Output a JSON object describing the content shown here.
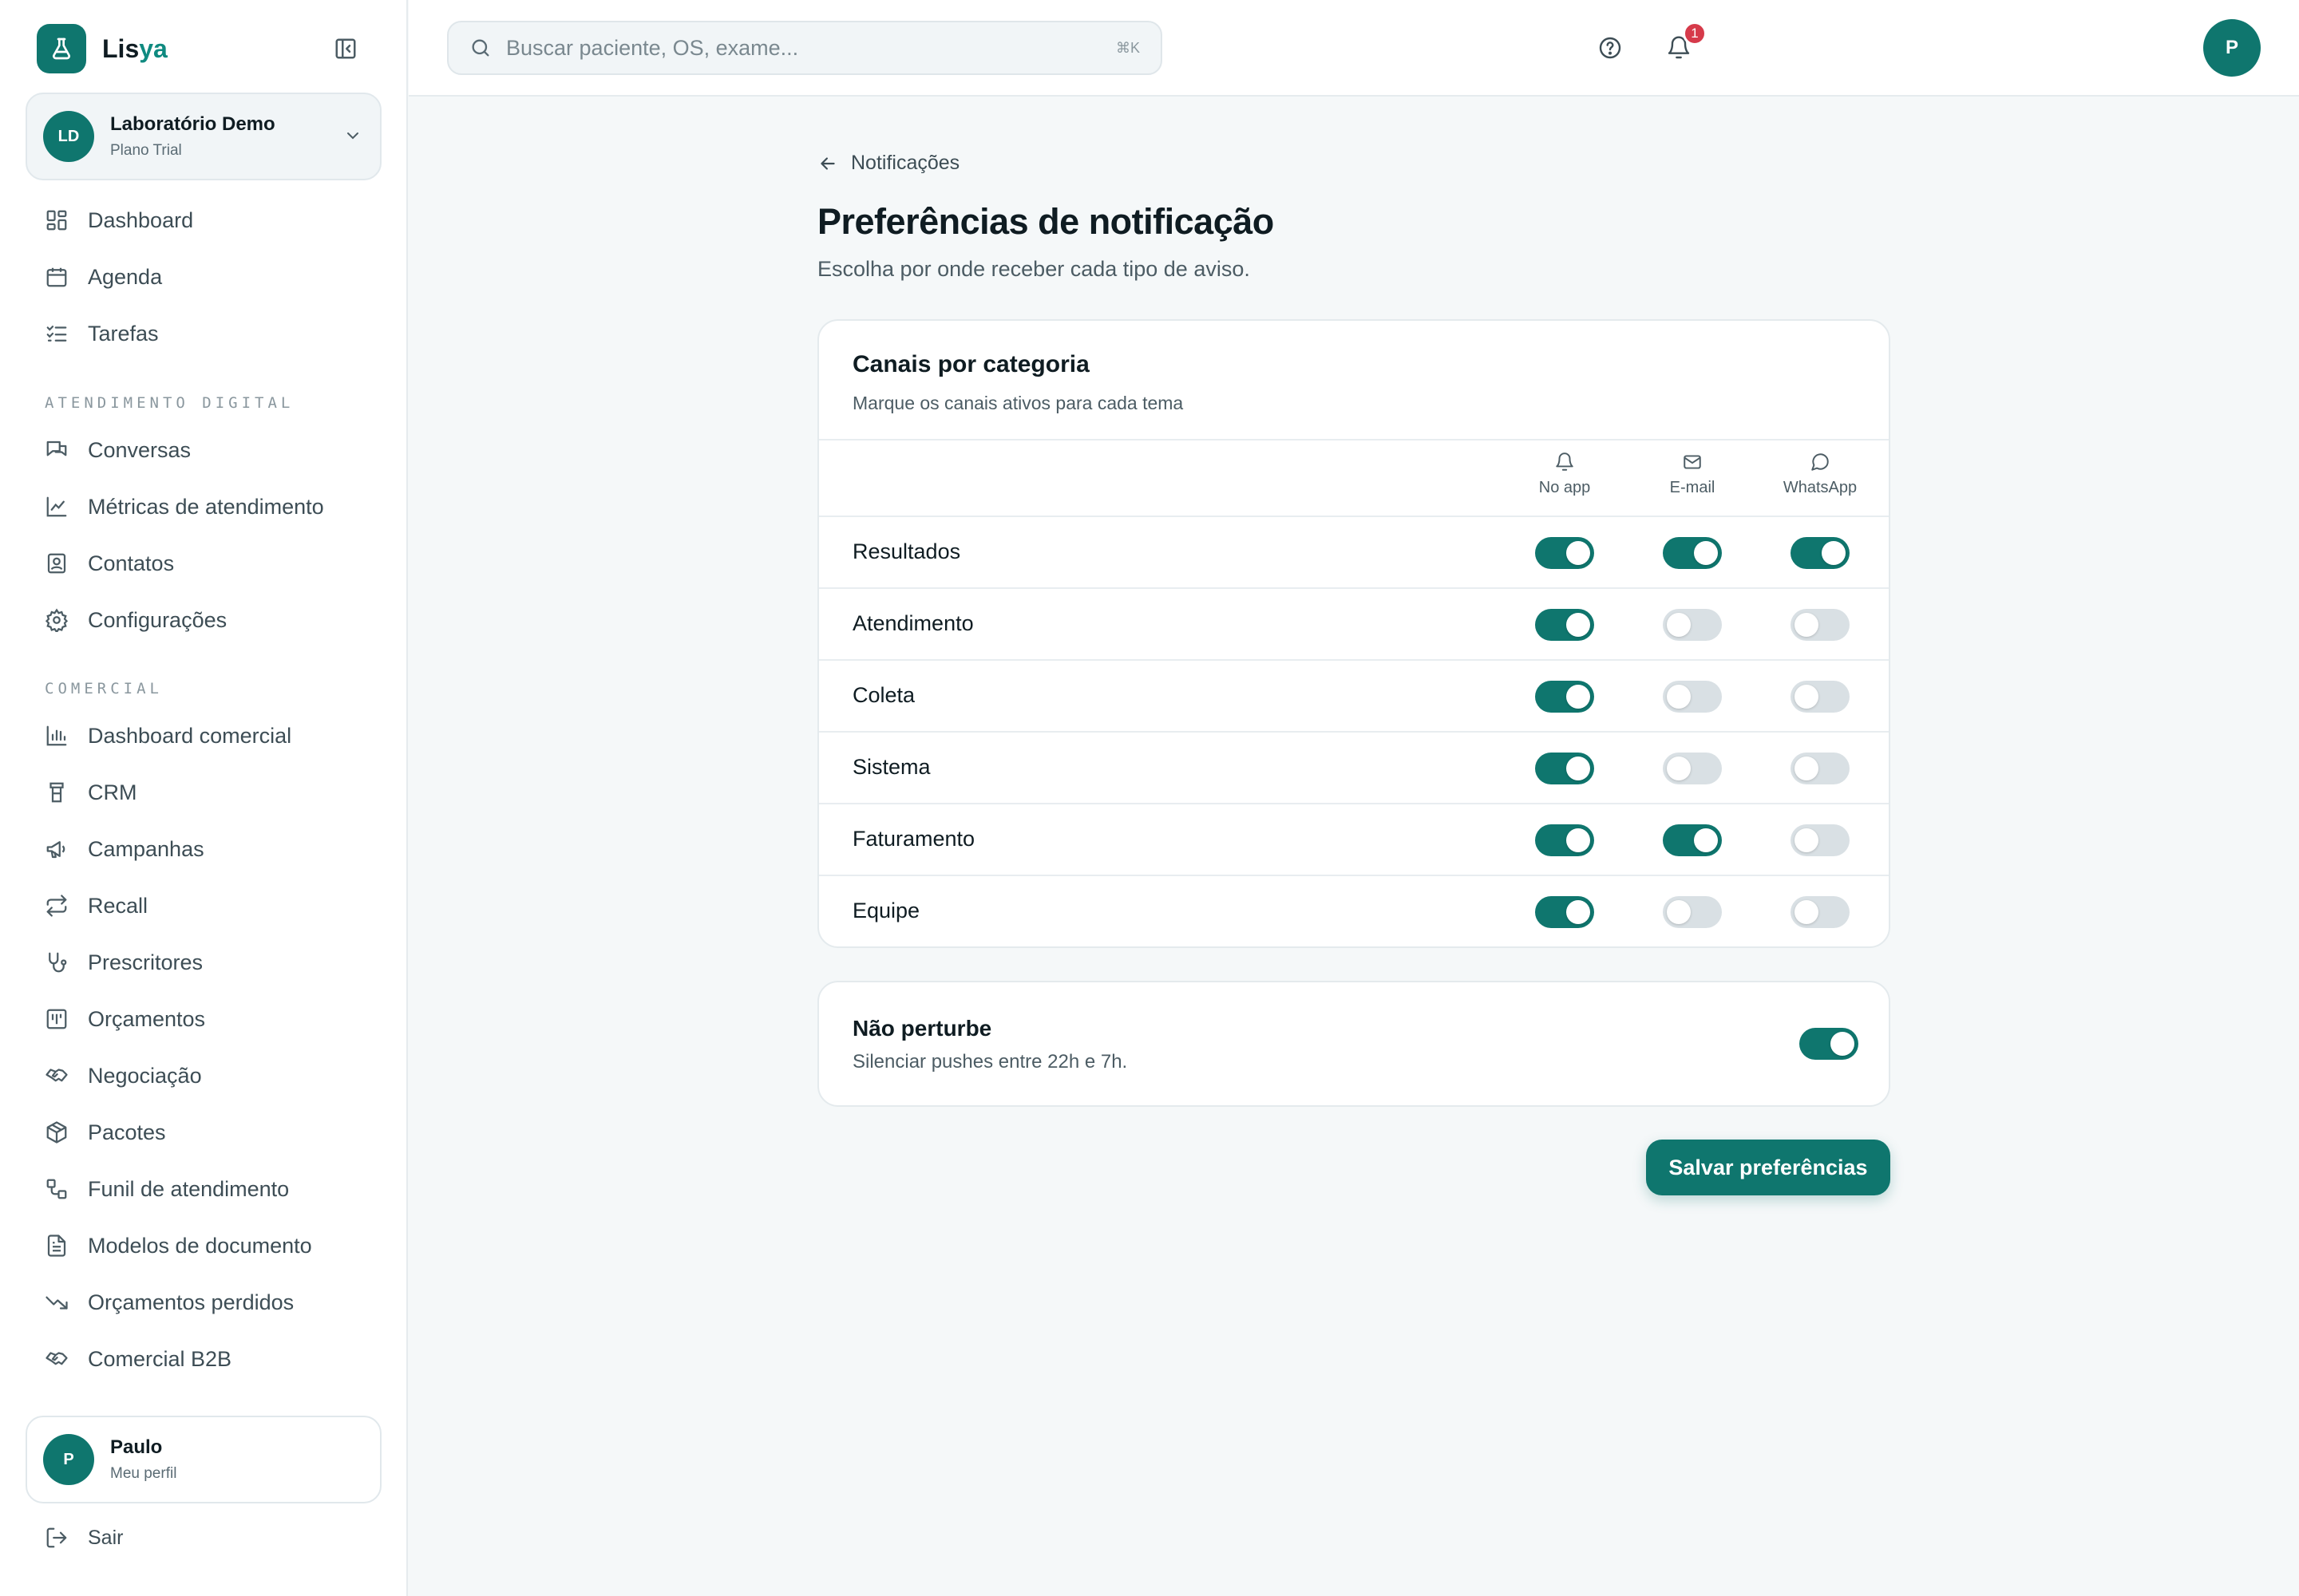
{
  "brand": {
    "name_part1": "Lis",
    "name_part2": "ya"
  },
  "org": {
    "initials": "LD",
    "name": "Laboratório Demo",
    "plan": "Plano Trial"
  },
  "nav_main": [
    {
      "label": "Dashboard",
      "icon": "dashboard-icon"
    },
    {
      "label": "Agenda",
      "icon": "calendar-icon"
    },
    {
      "label": "Tarefas",
      "icon": "checklist-icon"
    }
  ],
  "section_digital": "ATENDIMENTO DIGITAL",
  "nav_digital": [
    {
      "label": "Conversas",
      "icon": "chat-icon"
    },
    {
      "label": "Métricas de atendimento",
      "icon": "line-chart-icon"
    },
    {
      "label": "Contatos",
      "icon": "contact-icon"
    },
    {
      "label": "Configurações",
      "icon": "gear-icon"
    }
  ],
  "section_comercial": "COMERCIAL",
  "nav_comercial": [
    {
      "label": "Dashboard comercial",
      "icon": "bar-chart-icon"
    },
    {
      "label": "CRM",
      "icon": "crm-icon"
    },
    {
      "label": "Campanhas",
      "icon": "megaphone-icon"
    },
    {
      "label": "Recall",
      "icon": "repeat-icon"
    },
    {
      "label": "Prescritores",
      "icon": "stethoscope-icon"
    },
    {
      "label": "Orçamentos",
      "icon": "budget-icon"
    },
    {
      "label": "Negociação",
      "icon": "handshake-icon"
    },
    {
      "label": "Pacotes",
      "icon": "package-icon"
    },
    {
      "label": "Funil de atendimento",
      "icon": "workflow-icon"
    },
    {
      "label": "Modelos de documento",
      "icon": "document-icon"
    },
    {
      "label": "Orçamentos perdidos",
      "icon": "trending-down-icon"
    },
    {
      "label": "Comercial B2B",
      "icon": "handshake-icon"
    }
  ],
  "user": {
    "initial": "P",
    "name": "Paulo",
    "subtitle": "Meu perfil"
  },
  "logout_label": "Sair",
  "search": {
    "placeholder": "Buscar paciente, OS, exame...",
    "shortcut": "⌘K"
  },
  "notifications_count": "1",
  "top_avatar_initial": "P",
  "back_label": "Notificações",
  "page_title": "Preferências de notificação",
  "page_subtitle": "Escolha por onde receber cada tipo de aviso.",
  "channels_card": {
    "title": "Canais por categoria",
    "description": "Marque os canais ativos para cada tema",
    "columns": [
      {
        "label": "No app",
        "icon": "bell-icon"
      },
      {
        "label": "E-mail",
        "icon": "mail-icon"
      },
      {
        "label": "WhatsApp",
        "icon": "message-circle-icon"
      }
    ],
    "rows": [
      {
        "category": "Resultados",
        "app": true,
        "email": true,
        "whatsapp": true
      },
      {
        "category": "Atendimento",
        "app": true,
        "email": false,
        "whatsapp": false
      },
      {
        "category": "Coleta",
        "app": true,
        "email": false,
        "whatsapp": false
      },
      {
        "category": "Sistema",
        "app": true,
        "email": false,
        "whatsapp": false
      },
      {
        "category": "Faturamento",
        "app": true,
        "email": true,
        "whatsapp": false
      },
      {
        "category": "Equipe",
        "app": true,
        "email": false,
        "whatsapp": false
      }
    ]
  },
  "dnd": {
    "title": "Não perturbe",
    "description": "Silenciar pushes entre 22h e 7h.",
    "enabled": true
  },
  "save_label": "Salvar preferências",
  "colors": {
    "accent": "#0f766e",
    "badge": "#d63a4a",
    "toggle_off": "#d9e0e4"
  }
}
